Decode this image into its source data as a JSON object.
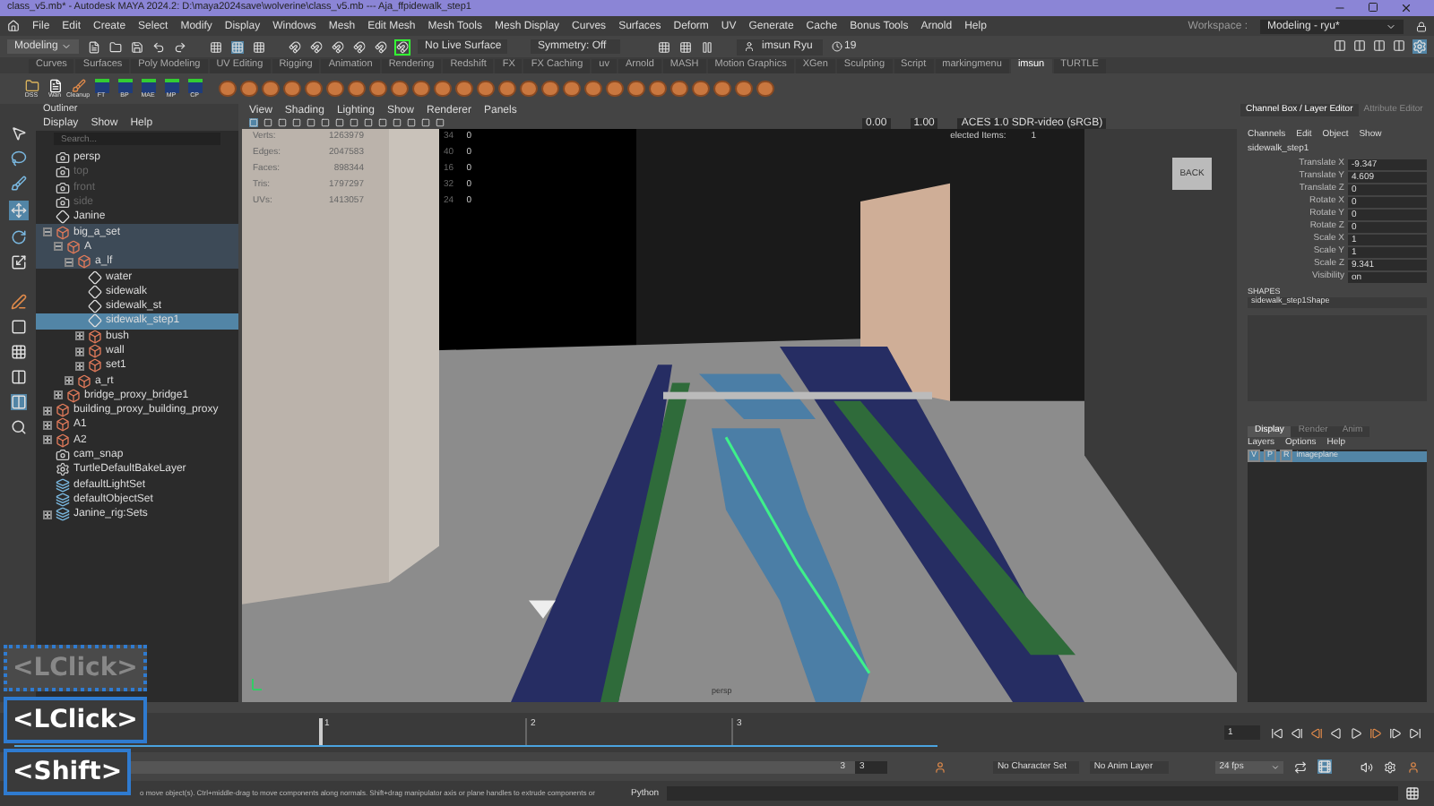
{
  "window": {
    "title": "class_v5.mb* - Autodesk MAYA 2024.2: D:\\maya2024save\\wolverine\\class_v5.mb  ---  Aja_ffpidewalk_step1"
  },
  "menu_bar": [
    "File",
    "Edit",
    "Create",
    "Select",
    "Modify",
    "Display",
    "Windows",
    "Mesh",
    "Edit Mesh",
    "Mesh Tools",
    "Mesh Display",
    "Curves",
    "Surfaces",
    "Deform",
    "UV",
    "Generate",
    "Cache",
    "Bonus Tools",
    "Arnold",
    "Help"
  ],
  "workspace": {
    "label": "Workspace :",
    "value": "Modeling - ryu*"
  },
  "status_line": {
    "mode": "Modeling",
    "live_surface": "No Live Surface",
    "symmetry": "Symmetry: Off",
    "user": "imsun Ryu",
    "history": "19"
  },
  "shelf": {
    "tabs": [
      {
        "label": "Curves",
        "selected": false
      },
      {
        "label": "Surfaces",
        "selected": false
      },
      {
        "label": "Poly Modeling",
        "selected": false
      },
      {
        "label": "UV Editing",
        "selected": false
      },
      {
        "label": "Rigging",
        "selected": false
      },
      {
        "label": "Animation",
        "selected": false
      },
      {
        "label": "Rendering",
        "selected": false
      },
      {
        "label": "Redshift",
        "selected": false
      },
      {
        "label": "FX",
        "selected": false
      },
      {
        "label": "FX Caching",
        "selected": false
      },
      {
        "label": "uv",
        "selected": false
      },
      {
        "label": "Arnold",
        "selected": false
      },
      {
        "label": "MASH",
        "selected": false
      },
      {
        "label": "Motion Graphics",
        "selected": false
      },
      {
        "label": "XGen",
        "selected": false
      },
      {
        "label": "Sculpting",
        "selected": false
      },
      {
        "label": "Script",
        "selected": false
      },
      {
        "label": "markingmenu",
        "selected": false
      },
      {
        "label": "imsun",
        "selected": true
      },
      {
        "label": "TURTLE",
        "selected": false
      }
    ],
    "buttons": [
      {
        "label": "DSS",
        "kind": "folder"
      },
      {
        "label": "Wan",
        "kind": "note"
      },
      {
        "label": "Cleanup",
        "kind": "tool"
      },
      {
        "label": "FT",
        "kind": "pin"
      },
      {
        "label": "BP",
        "kind": "pin"
      },
      {
        "label": "MAE",
        "kind": "pin"
      },
      {
        "label": "MP",
        "kind": "pin"
      },
      {
        "label": "CP",
        "kind": "pin"
      }
    ]
  },
  "outliner": {
    "title": "Outliner",
    "menu": [
      "Display",
      "Show",
      "Help"
    ],
    "search_placeholder": "Search...",
    "items": [
      {
        "label": "persp",
        "kind": "camera",
        "dimmed": false,
        "selected": false
      },
      {
        "label": "top",
        "kind": "camera",
        "dimmed": true,
        "selected": false
      },
      {
        "label": "front",
        "kind": "camera",
        "dimmed": true,
        "selected": false
      },
      {
        "label": "side",
        "kind": "camera",
        "dimmed": true,
        "selected": false
      },
      {
        "label": "Janine",
        "kind": "transform",
        "dimmed": false,
        "selected": false
      },
      {
        "label": "big_a_set",
        "kind": "group",
        "dimmed": false,
        "selected": false,
        "expanded": true,
        "children": [
          {
            "label": "A",
            "kind": "group",
            "dimmed": false,
            "selected": false,
            "expanded": true,
            "children": [
              {
                "label": "a_lf",
                "kind": "group",
                "dimmed": false,
                "selected": false,
                "expanded": true,
                "children": [
                  {
                    "label": "water",
                    "kind": "transform",
                    "dimmed": false,
                    "selected": false
                  },
                  {
                    "label": "sidewalk",
                    "kind": "transform",
                    "dimmed": false,
                    "selected": false
                  },
                  {
                    "label": "sidewalk_st",
                    "kind": "transform",
                    "dimmed": false,
                    "selected": false
                  },
                  {
                    "label": "sidewalk_step1",
                    "kind": "transform",
                    "dimmed": false,
                    "selected": true
                  },
                  {
                    "label": "bush",
                    "kind": "group",
                    "dimmed": false,
                    "selected": false,
                    "expanded": false
                  },
                  {
                    "label": "wall",
                    "kind": "group",
                    "dimmed": false,
                    "selected": false,
                    "expanded": false
                  },
                  {
                    "label": "set1",
                    "kind": "group",
                    "dimmed": false,
                    "selected": false,
                    "expanded": false
                  }
                ]
              },
              {
                "label": "a_rt",
                "kind": "group",
                "dimmed": false,
                "selected": false,
                "expanded": false
              }
            ]
          },
          {
            "label": "bridge_proxy_bridge1",
            "kind": "group",
            "dimmed": false,
            "selected": false,
            "expanded": false
          }
        ]
      },
      {
        "label": "building_proxy_building_proxy",
        "kind": "group",
        "dimmed": false,
        "selected": false,
        "expanded": false
      },
      {
        "label": "A1",
        "kind": "group",
        "dimmed": false,
        "selected": false,
        "expanded": false
      },
      {
        "label": "A2",
        "kind": "group",
        "dimmed": false,
        "selected": false,
        "expanded": false
      },
      {
        "label": "cam_snap",
        "kind": "camera",
        "dimmed": false,
        "selected": false
      },
      {
        "label": "TurtleDefaultBakeLayer",
        "kind": "gear",
        "dimmed": false,
        "selected": false
      },
      {
        "label": "defaultLightSet",
        "kind": "set",
        "dimmed": false,
        "selected": false
      },
      {
        "label": "defaultObjectSet",
        "kind": "set",
        "dimmed": false,
        "selected": false
      },
      {
        "label": "Janine_rig:Sets",
        "kind": "set",
        "dimmed": false,
        "selected": false,
        "expanded": false
      }
    ]
  },
  "viewport": {
    "menu": [
      "View",
      "Shading",
      "Lighting",
      "Show",
      "Renderer",
      "Panels"
    ],
    "gamma": "0.00",
    "exposure": "1.00",
    "color_space": "ACES 1.0 SDR-video (sRGB)",
    "stats": [
      {
        "label": "Verts:",
        "value": "1263979",
        "column_2": "34",
        "column_3": "0"
      },
      {
        "label": "Edges:",
        "value": "2047583",
        "column_2": "40",
        "column_3": "0"
      },
      {
        "label": "Faces:",
        "value": "898344",
        "column_2": "16",
        "column_3": "0"
      },
      {
        "label": "Tris:",
        "value": "1797297",
        "column_2": "32",
        "column_3": "0"
      },
      {
        "label": "UVs:",
        "value": "1413057",
        "column_2": "24",
        "column_3": "0"
      }
    ],
    "selected_items": {
      "label": "elected Items:",
      "value": "1"
    },
    "view_cube": "BACK",
    "camera": "persp"
  },
  "channel_box": {
    "tabs": [
      {
        "label": "Channel Box / Layer Editor",
        "selected": true
      },
      {
        "label": "Attribute Editor",
        "selected": false
      }
    ],
    "menu": [
      "Channels",
      "Edit",
      "Object",
      "Show"
    ],
    "object": "sidewalk_step1",
    "attributes": [
      {
        "name": "Translate X",
        "value": "-9.347"
      },
      {
        "name": "Translate Y",
        "value": "4.609"
      },
      {
        "name": "Translate Z",
        "value": "0"
      },
      {
        "name": "Rotate X",
        "value": "0"
      },
      {
        "name": "Rotate Y",
        "value": "0"
      },
      {
        "name": "Rotate Z",
        "value": "0"
      },
      {
        "name": "Scale X",
        "value": "1"
      },
      {
        "name": "Scale Y",
        "value": "1"
      },
      {
        "name": "Scale Z",
        "value": "9.341"
      },
      {
        "name": "Visibility",
        "value": "on"
      }
    ],
    "shapes_label": "SHAPES",
    "shape": "sidewalk_step1Shape"
  },
  "layer_editor": {
    "tabs": [
      {
        "label": "Display",
        "selected": true
      },
      {
        "label": "Render",
        "selected": false
      },
      {
        "label": "Anim",
        "selected": false
      }
    ],
    "menu": [
      "Layers",
      "Options",
      "Help"
    ],
    "layers": [
      {
        "visible": "V",
        "playback": "P",
        "reference": "R",
        "name": "imageplane",
        "selected": true
      }
    ]
  },
  "time_slider": {
    "ticks": [
      "1",
      "2",
      "3"
    ],
    "level": 0,
    "frame_field": "1"
  },
  "range_slider": {
    "end": "3",
    "end_field": "3",
    "level": 1
  },
  "anim_controls": {
    "character_set": "No Character Set",
    "anim_layer": "No Anim Layer",
    "fps": "24 fps"
  },
  "help_line": "o move object(s). Ctrl+middle-drag to move components along normals. Shift+drag manipulator axis or plane handles to extrude components or",
  "command_line": {
    "language": "Python"
  },
  "key_overlays": [
    {
      "text": "<LClick>",
      "faded": true
    },
    {
      "text": "<LClick>",
      "faded": false
    },
    {
      "text": "<Shift>",
      "faded": false
    }
  ]
}
